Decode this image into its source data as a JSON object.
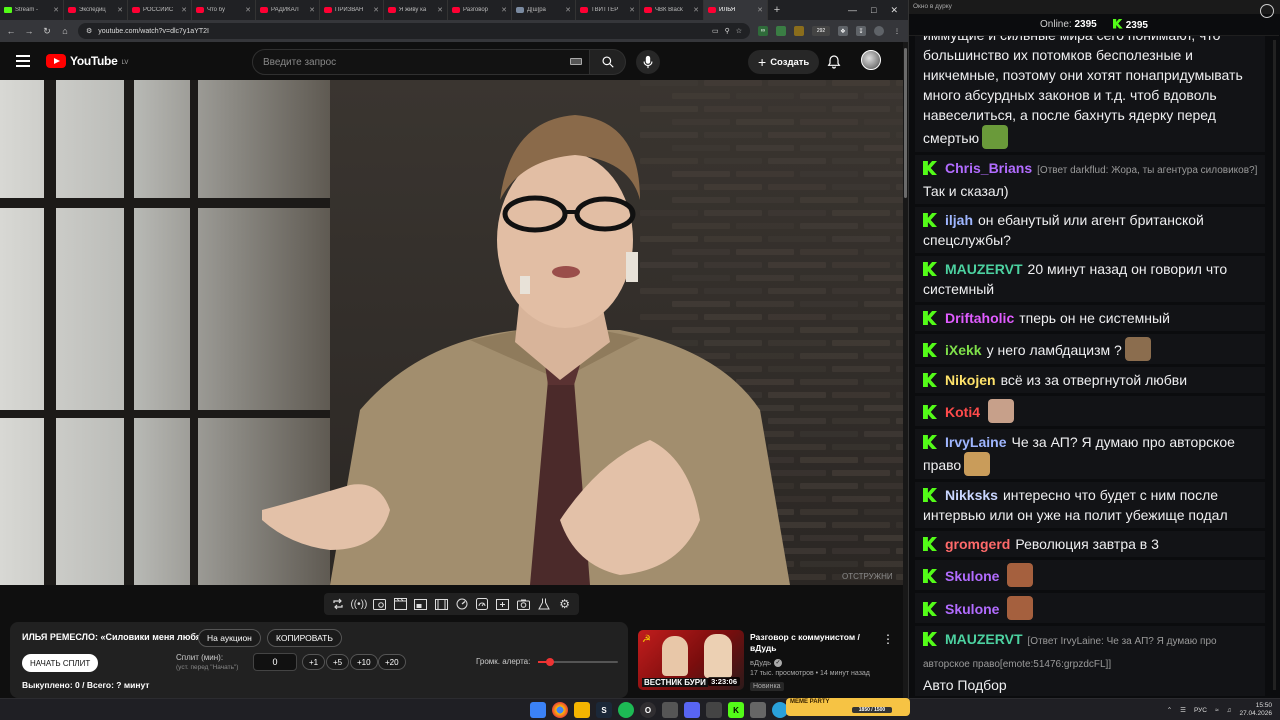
{
  "browser": {
    "tabs": [
      {
        "label": "Stream - ",
        "icon": "kick",
        "active": false
      },
      {
        "label": "Экспедиц",
        "icon": "youtube",
        "active": false
      },
      {
        "label": "РОССИЙС",
        "icon": "youtube",
        "active": false
      },
      {
        "label": "Что бу",
        "icon": "youtube",
        "active": false
      },
      {
        "label": "РАДИКАЛ",
        "icon": "youtube",
        "active": false
      },
      {
        "label": "ПРИЗВАН",
        "icon": "youtube",
        "active": false
      },
      {
        "label": "Я живу ка",
        "icon": "youtube",
        "active": false
      },
      {
        "label": "Разговор",
        "icon": "youtube",
        "active": false
      },
      {
        "label": "Д[ш]ра",
        "icon": "doc",
        "active": false
      },
      {
        "label": "ТВИТТЕР",
        "icon": "youtube",
        "active": false
      },
      {
        "label": "ЧВК Black",
        "icon": "youtube",
        "active": false
      },
      {
        "label": "ИЛЬЯ",
        "icon": "youtube",
        "active": true
      }
    ],
    "new_tab": "+",
    "url": "youtube.com/watch?v=dlc7y1aYT2I",
    "ext_badge": "292"
  },
  "youtube": {
    "logo_word": "YouTube",
    "logo_region": "LV",
    "search_placeholder": "Введите запрос",
    "create_label": "Создать"
  },
  "video": {
    "watermark": "ОТСТРУЖНИ"
  },
  "auction": {
    "title": "ИЛЬЯ РЕМЕСЛО: «Силовики меня любят»",
    "auction_btn": "На аукцион",
    "copy_btn": "КОПИРОВАТЬ",
    "start_split_btn": "НАЧАТЬ СПЛИТ",
    "split_label": "Сплит (мин):",
    "split_hint": "(уст. перед \"Начать\")",
    "split_value": "0",
    "steps": [
      "+1",
      "+5",
      "+10",
      "+20"
    ],
    "volume_label": "Громк. алерта:",
    "volume_level": 0.15,
    "bought": "Выкуплено: 0 / Всего: ? минут"
  },
  "related": {
    "title": "Разговор с коммунистом / вДудь",
    "channel": "вДудь",
    "meta": "17 тыс. просмотров • 14 минут назад",
    "badge": "Новинка",
    "thumb_caption": "ВЕСТНИК БУРИ",
    "duration": "3:23:06"
  },
  "chat": {
    "window_title": "Окно в дурку",
    "online_label": "Online:",
    "online_count": "2395",
    "kick_count": "2395",
    "messages": [
      {
        "user": "",
        "color": "#ffffff",
        "reply": "",
        "text": "иммущие и сильные мира сего понимают, что большинство их потомков бесполезные и никчемные, поэтому они хотят понапридумывать много абсурдных законов и т.д. чтоб вдоволь навеселиться, а после бахнуть ядерку перед смертью",
        "emote": "#6a9a3a"
      },
      {
        "user": "Chris_Brians",
        "color": "#b26cff",
        "reply": "[Ответ darkflud: Жора, ты агентура силовиков?]",
        "text": "Так и сказал)",
        "emote": ""
      },
      {
        "user": "iljah",
        "color": "#9fb6ff",
        "reply": "",
        "text": "он ебанутый или агент британской спецслужбы?",
        "emote": ""
      },
      {
        "user": "MAUZERVT",
        "color": "#4cd1a0",
        "reply": "",
        "text": "20 минут назад он говорил что системный",
        "emote": ""
      },
      {
        "user": "Driftaholic",
        "color": "#e05cff",
        "reply": "",
        "text": "тперь он не системный",
        "emote": ""
      },
      {
        "user": "iXekk",
        "color": "#7fe04a",
        "reply": "",
        "text": "у него ламбдацизм ?",
        "emote": "#8b6d4e"
      },
      {
        "user": "Nikojen",
        "color": "#ffe36b",
        "reply": "",
        "text": "всё из за отвергнутой любви",
        "emote": ""
      },
      {
        "user": "Koti4",
        "color": "#ff4b4b",
        "reply": "",
        "text": "",
        "emote": "#c7a08a"
      },
      {
        "user": "IrvyLaine",
        "color": "#9fb6ff",
        "reply": "",
        "text": "Че за АП? Я думаю про авторское право",
        "emote": "#c99c5a"
      },
      {
        "user": "Nikksks",
        "color": "#c9d6ff",
        "reply": "",
        "text": "интересно что будет с ним после интервью или он уже на полит убежище подал",
        "emote": ""
      },
      {
        "user": "gromgerd",
        "color": "#ff6a6a",
        "reply": "",
        "text": "Революция завтра в 3",
        "emote": ""
      },
      {
        "user": "Skulone",
        "color": "#b26cff",
        "reply": "",
        "text": "",
        "emote": "#a5603e"
      },
      {
        "user": "Skulone",
        "color": "#b26cff",
        "reply": "",
        "text": "",
        "emote": "#a5603e"
      },
      {
        "user": "MAUZERVT",
        "color": "#4cd1a0",
        "reply": "[Ответ IrvyLaine: Че за АП? Я думаю про авторское право[emote:51476:grpzdcFL]]",
        "text": "Авто Подбор",
        "emote": ""
      }
    ]
  },
  "taskbar": {
    "meme_title": "MEME PARTY",
    "meme_progress": "1850 / 1500",
    "lang": "РУС",
    "time": "15:50",
    "date": "27.04.2026"
  }
}
